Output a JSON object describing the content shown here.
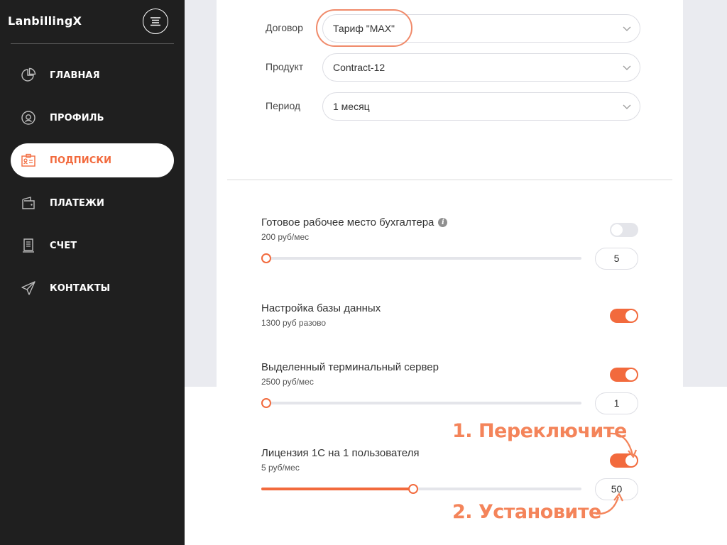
{
  "brand": "LanbillingX",
  "nav": [
    {
      "label": "ГЛАВНАЯ",
      "icon": "pie-chart-icon",
      "active": false
    },
    {
      "label": "ПРОФИЛЬ",
      "icon": "user-circle-icon",
      "active": false
    },
    {
      "label": "ПОДПИСКИ",
      "icon": "id-card-icon",
      "active": true
    },
    {
      "label": "ПЛАТЕЖИ",
      "icon": "wallet-icon",
      "active": false
    },
    {
      "label": "СЧЕТ",
      "icon": "receipt-icon",
      "active": false
    },
    {
      "label": "КОНТАКТЫ",
      "icon": "paper-plane-icon",
      "active": false
    }
  ],
  "form": {
    "contract": {
      "label": "Договор",
      "value": "Тариф \"MAX\""
    },
    "product": {
      "label": "Продукт",
      "value": "Contract-12"
    },
    "period": {
      "label": "Период",
      "value": "1 месяц"
    }
  },
  "services": [
    {
      "title": "Готовое рабочее место бухгалтера",
      "price": "200 руб/мес",
      "enabled": false,
      "quantity": "5",
      "slider_fraction": 0.0
    },
    {
      "title": "Настройка базы данных",
      "price": "1300 руб разово",
      "enabled": true
    },
    {
      "title": "Выделенный терминальный сервер",
      "price": "2500 руб/мес",
      "enabled": true,
      "quantity": "1",
      "slider_fraction": 0.0
    },
    {
      "title": "Лицензия 1С на 1 пользователя",
      "price": "5 руб/мес",
      "enabled": true,
      "quantity": "50",
      "slider_fraction": 0.475
    }
  ],
  "annotations": {
    "step1": "1. Переключите",
    "step2": "2. Установите"
  },
  "colors": {
    "accent": "#f26a3d",
    "sidebar": "#1f1f1f",
    "annotation": "#f4845a"
  }
}
